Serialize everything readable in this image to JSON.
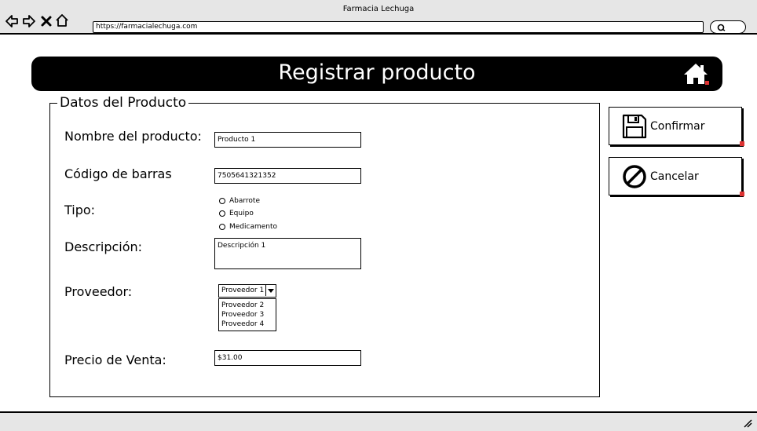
{
  "window": {
    "title": "Farmacia Lechuga",
    "url": "https://farmacialechuga.com"
  },
  "header": {
    "title": "Registrar producto",
    "home_icon": "home-icon"
  },
  "form": {
    "legend": "Datos del Producto",
    "fields": {
      "nombre": {
        "label": "Nombre del producto:",
        "value": "Producto 1"
      },
      "codigo": {
        "label": "Código de barras",
        "value": "7505641321352"
      },
      "tipo": {
        "label": "Tipo:",
        "options": [
          "Abarrote",
          "Equipo",
          "Medicamento"
        ]
      },
      "descripcion": {
        "label": "Descripción:",
        "value": "Descripción 1"
      },
      "proveedor": {
        "label": "Proveedor:",
        "selected": "Proveedor 1",
        "options": [
          "Proveedor 2",
          "Proveedor 3",
          "Proveedor 4"
        ]
      },
      "precio": {
        "label": "Precio de Venta:",
        "value": "$31.00"
      }
    }
  },
  "actions": {
    "confirm": {
      "label": "Confirmar",
      "icon": "save-icon"
    },
    "cancel": {
      "label": "Cancelar",
      "icon": "cancel-icon"
    }
  }
}
